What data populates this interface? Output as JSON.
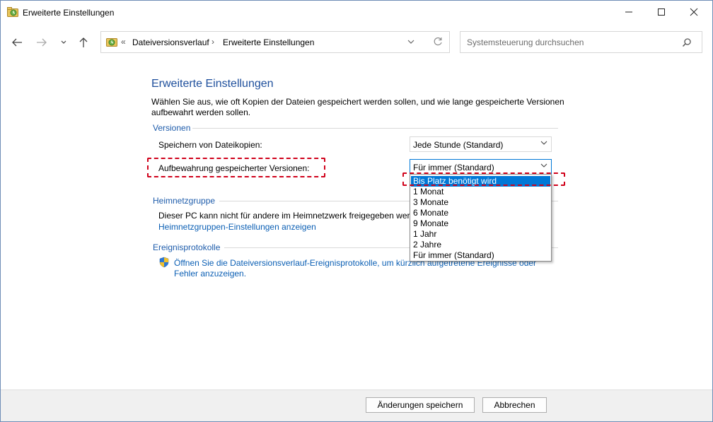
{
  "window": {
    "title": "Erweiterte Einstellungen"
  },
  "address": {
    "prefix": "«",
    "crumb1": "Dateiversionsverlauf",
    "separator": "›",
    "crumb2": "Erweiterte Einstellungen"
  },
  "search": {
    "placeholder": "Systemsteuerung durchsuchen"
  },
  "page": {
    "heading": "Erweiterte Einstellungen",
    "description_line1": "Wählen Sie aus, wie oft Kopien der Dateien gespeichert werden sollen, und wie lange gespeicherte Versionen",
    "description_line2": "aufbewahrt werden sollen."
  },
  "versions": {
    "header": "Versionen",
    "save_copies_label": "Speichern von Dateikopien:",
    "save_copies_value": "Jede Stunde (Standard)",
    "retention_label": "Aufbewahrung gespeicherter Versionen:",
    "retention_value": "Für immer (Standard)",
    "retention_options": [
      "Bis Platz benötigt wird",
      "1 Monat",
      "3 Monate",
      "6 Monate",
      "9 Monate",
      "1 Jahr",
      "2 Jahre",
      "Für immer (Standard)"
    ]
  },
  "homegroup": {
    "header": "Heimnetzgruppe",
    "text": "Dieser PC kann nicht für andere im Heimnetzwerk freigegeben werden.",
    "link": "Heimnetzgruppen-Einstellungen anzeigen"
  },
  "eventlogs": {
    "header": "Ereignisprotokolle",
    "link_line1": "Öffnen Sie die Dateiversionsverlauf-Ereignisprotokolle, um kürzlich aufgetretene Ereignisse oder",
    "link_line2": "Fehler anzuzeigen."
  },
  "footer": {
    "save_label": "Änderungen speichern",
    "cancel_label": "Abbrechen"
  },
  "colors": {
    "accent": "#0078d7",
    "link": "#0b5fb4",
    "annotation": "#d0021b"
  }
}
